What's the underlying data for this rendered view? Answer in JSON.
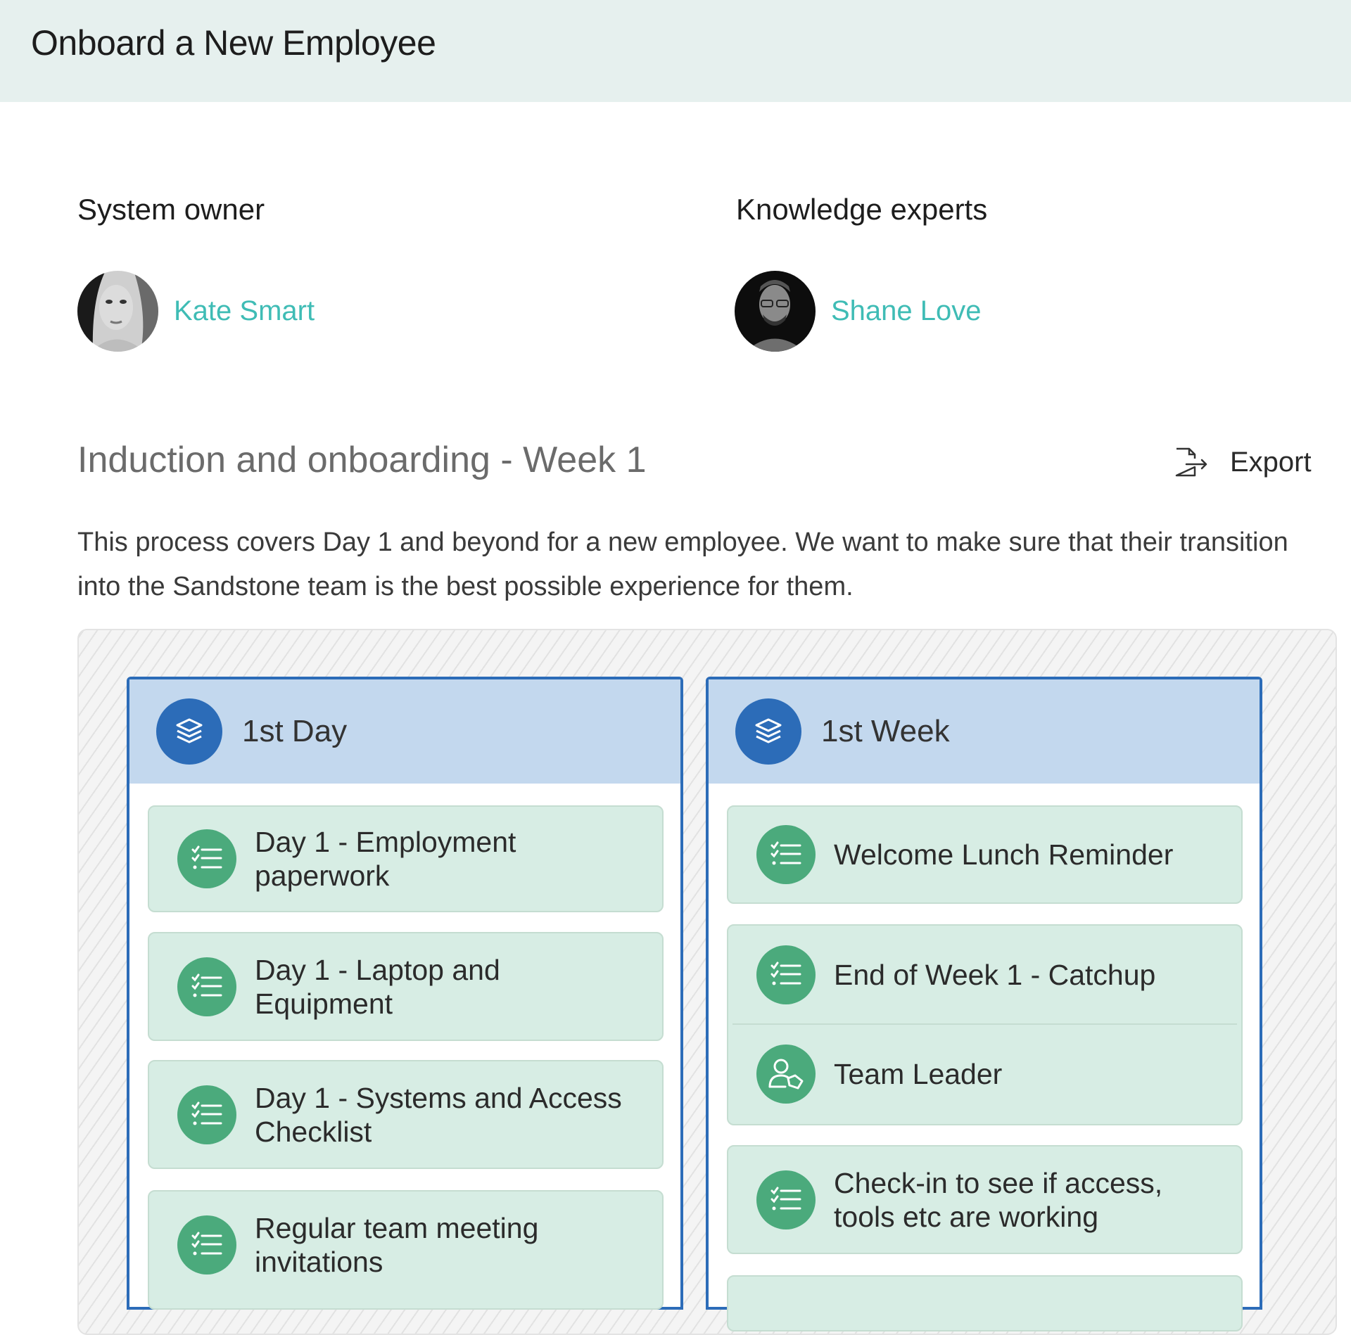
{
  "header": {
    "title": "Onboard a New Employee"
  },
  "owners": {
    "system_owner_label": "System owner",
    "system_owner": {
      "name": "Kate Smart",
      "avatar": "photo-avatar-woman"
    },
    "experts_label": "Knowledge experts",
    "experts": [
      {
        "name": "Shane Love",
        "avatar": "photo-avatar-man"
      }
    ]
  },
  "section": {
    "title": "Induction and onboarding - Week 1",
    "export_label": "Export",
    "export_icon": "export-icon",
    "description": "This process covers Day 1 and beyond for a new employee. We want to make sure that their transition into the Sandstone team is the best possible experience for them."
  },
  "colors": {
    "header_bg": "#e6f0ee",
    "link": "#3fbcb5",
    "lane_border": "#2c6cb8",
    "lane_header_bg": "#c3d8ee",
    "card_bg": "#d7ede4",
    "card_icon_bg": "#4baa7c"
  },
  "lanes": [
    {
      "title": "1st Day",
      "icon": "layers-icon",
      "cards": [
        {
          "text": "Day 1 - Employment paperwork",
          "icon": "checklist-icon"
        },
        {
          "text": "Day 1 - Laptop and Equipment",
          "icon": "checklist-icon"
        },
        {
          "text": "Day 1 - Systems and Access Checklist",
          "icon": "checklist-icon"
        },
        {
          "text": "Regular team meeting invitations",
          "icon": "checklist-icon"
        }
      ]
    },
    {
      "title": "1st Week",
      "icon": "layers-icon",
      "cards": [
        {
          "text": "Welcome Lunch Reminder",
          "icon": "checklist-icon"
        },
        {
          "text": "End of Week 1 - Catchup",
          "icon": "checklist-icon",
          "role": {
            "text": "Team Leader",
            "icon": "role-icon"
          }
        },
        {
          "text": "Check-in to see if access, tools etc are working",
          "icon": "checklist-icon"
        },
        {
          "text": "",
          "icon": ""
        }
      ]
    }
  ]
}
